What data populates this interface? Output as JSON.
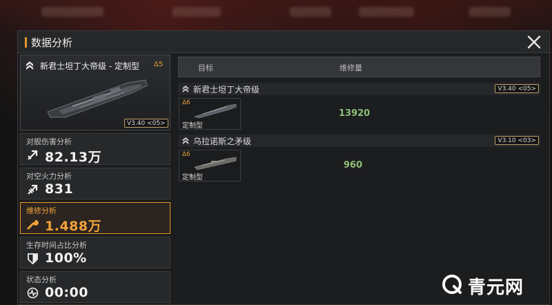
{
  "window": {
    "title": "数据分析"
  },
  "ship": {
    "name": "新君士坦丁大帝级 - 定制型",
    "tier": "Δ5",
    "version": "V3.40 <05>"
  },
  "stats": [
    {
      "label": "对舰伤害分析",
      "value": "82.13万",
      "icon": "damage-arrow-icon"
    },
    {
      "label": "对空火力分析",
      "value": "831",
      "icon": "antiair-arrow-icon"
    },
    {
      "label": "维修分析",
      "value": "1.488万",
      "icon": "wrench-icon",
      "active": true
    },
    {
      "label": "生存时间占比分析",
      "value": "100%",
      "icon": "shield-icon"
    },
    {
      "label": "状态分析",
      "value": "00:00",
      "icon": "status-pulse-icon"
    }
  ],
  "table": {
    "columns": [
      "目标",
      "维修量"
    ],
    "groups": [
      {
        "name": "新君士坦丁大帝级",
        "version": "V3.40 <05>",
        "tier": "Δ6",
        "type": "定制型",
        "value": "13920"
      },
      {
        "name": "乌拉诺斯之矛级",
        "version": "V3.10 <03>",
        "tier": "Δ6",
        "type": "定制型",
        "value": "960"
      }
    ]
  },
  "watermark": {
    "text": "青元网"
  },
  "colors": {
    "accent": "#e89a2c",
    "repair_value": "#8fbf7a",
    "panel": "#1c1d1e"
  }
}
